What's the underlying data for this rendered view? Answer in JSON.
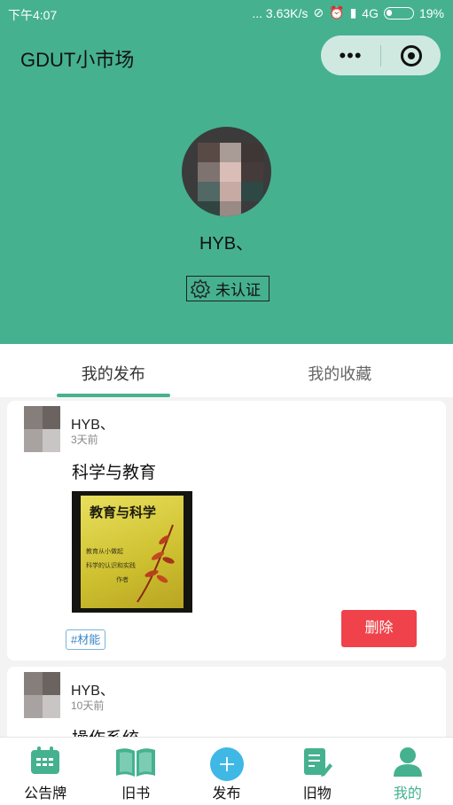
{
  "statusbar": {
    "time": "下午4:07",
    "network_speed": "... 3.63K/s",
    "network_type": "4G",
    "battery": "19%"
  },
  "header": {
    "app_title": "GDUT小市场",
    "more_icon": "more-dots-icon",
    "close_icon": "target-close-icon"
  },
  "profile": {
    "username": "HYB、",
    "cert_status": "未认证"
  },
  "tabs": [
    {
      "label": "我的发布",
      "active": true
    },
    {
      "label": "我的收藏",
      "active": false
    }
  ],
  "posts": [
    {
      "poster_name": "HYB、",
      "time_ago": "3天前",
      "title": "科学与教育",
      "cover": {
        "title": "教育与科学",
        "lines": [
          "教育从小做起",
          "科学的认识和实践",
          "作者"
        ]
      },
      "tag": "#材能",
      "delete_label": "删除"
    },
    {
      "poster_name": "HYB、",
      "time_ago": "10天前",
      "title": "操作系统"
    }
  ],
  "bottom_nav": [
    {
      "label": "公告牌",
      "icon": "calendar-board-icon",
      "active": false
    },
    {
      "label": "旧书",
      "icon": "open-book-icon",
      "active": false
    },
    {
      "label": "发布",
      "icon": "plus-circle-icon",
      "active": false
    },
    {
      "label": "旧物",
      "icon": "note-edit-icon",
      "active": false
    },
    {
      "label": "我的",
      "icon": "user-icon",
      "active": true
    }
  ],
  "colors": {
    "brand_green": "#45b18f",
    "delete_red": "#f0424a",
    "tag_blue": "#3a86c6"
  }
}
